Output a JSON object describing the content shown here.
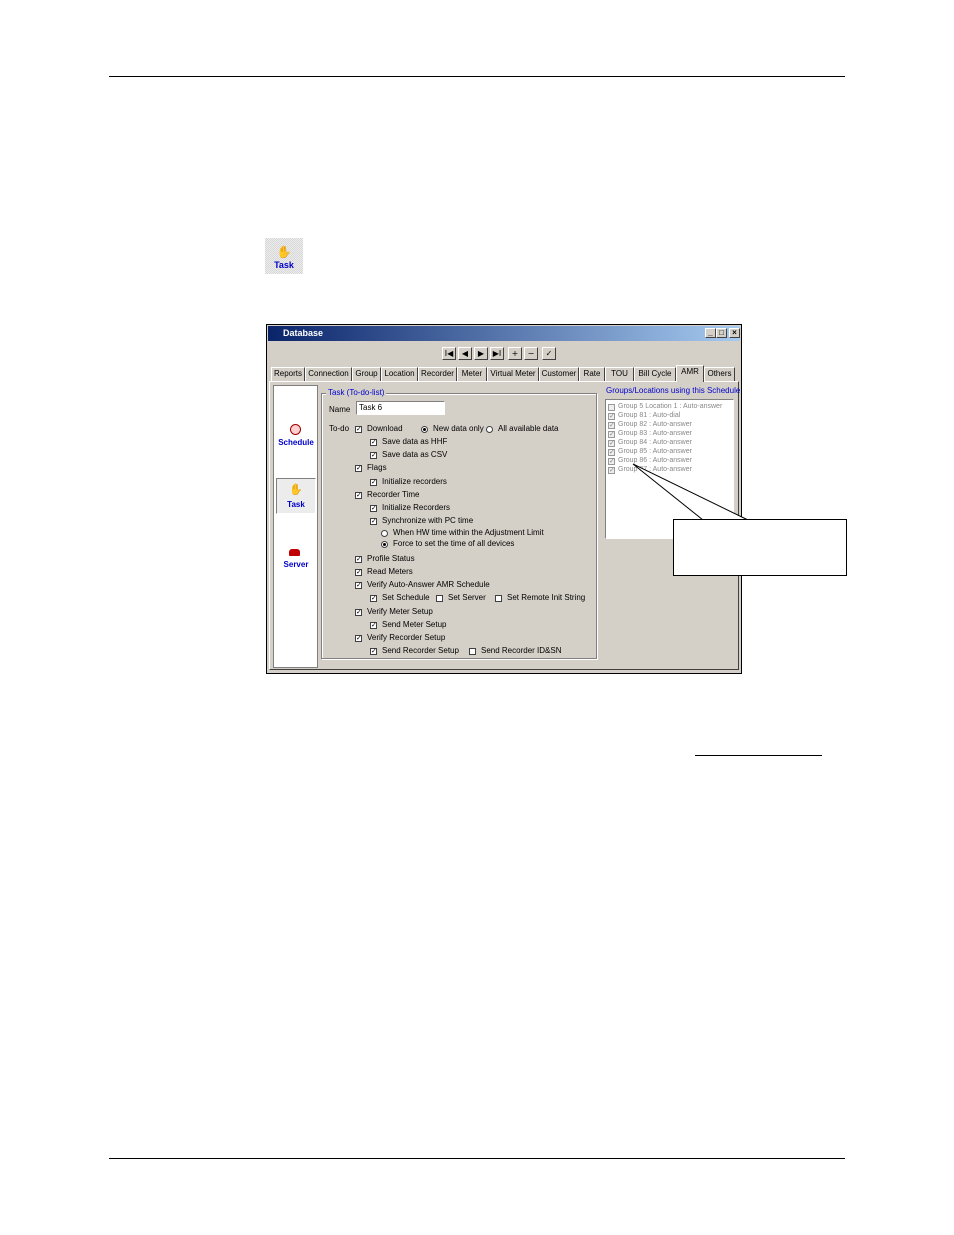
{
  "page_icon": {
    "label": "Task"
  },
  "window": {
    "title": "Database",
    "controls": {
      "minimize": "_",
      "maximize": "□",
      "close": "×"
    },
    "nav_buttons": [
      "I◀",
      "◀",
      "▶",
      "▶I",
      "+",
      "−",
      "✓"
    ],
    "tabs": [
      "Reports",
      "Connection",
      "Group",
      "Location",
      "Recorder",
      "Meter",
      "Virtual Meter",
      "Customer",
      "Rate",
      "TOU",
      "Bill Cycle",
      "AMR",
      "Others"
    ],
    "active_tab": "AMR",
    "sidebar": {
      "items": [
        {
          "label": "Schedule"
        },
        {
          "label": "Task"
        },
        {
          "label": "Server"
        }
      ]
    },
    "task_group": {
      "title": "Task (To-do-list)",
      "name_label": "Name",
      "name_value": "Task 6",
      "todo_label": "To-do",
      "download": "Download",
      "new_data_only": "New data only",
      "all_available_data": "All available data",
      "save_hhf": "Save data as HHF",
      "save_csv": "Save data as CSV",
      "flags": "Flags",
      "init_recorders_lower": "Initialize recorders",
      "recorder_time": "Recorder Time",
      "init_recorders": "Initialize Recorders",
      "sync_pc_time": "Synchronize with PC time",
      "when_hw_time": "When HW time within the Adjustment Limit",
      "force_set_time": "Force to set the time of all devices",
      "profile_status": "Profile Status",
      "read_meters": "Read Meters",
      "verify_amr": "Verify Auto-Answer AMR Schedule",
      "set_schedule": "Set Schedule",
      "set_server": "Set Server",
      "set_remote_init": "Set Remote Init String",
      "verify_meter_setup": "Verify Meter Setup",
      "send_meter_setup": "Send Meter Setup",
      "verify_recorder_setup": "Verify Recorder Setup",
      "send_recorder_setup": "Send Recorder Setup",
      "send_recorder_id": "Send Recorder ID&SN",
      "check": "✓"
    },
    "groups_panel": {
      "title": "Groups/Locations using this Schedule",
      "items": [
        {
          "label": "Group 5 Location 1 : Auto-answer",
          "checked": false
        },
        {
          "label": "Group 81 : Auto-dial",
          "checked": true
        },
        {
          "label": "Group 82 : Auto-answer",
          "checked": true
        },
        {
          "label": "Group 83 : Auto-answer",
          "checked": true
        },
        {
          "label": "Group 84 : Auto-answer",
          "checked": true
        },
        {
          "label": "Group 85 : Auto-answer",
          "checked": true
        },
        {
          "label": "Group 86 : Auto-answer",
          "checked": true
        },
        {
          "label": "Group 87 : Auto-answer",
          "checked": true
        }
      ]
    }
  }
}
